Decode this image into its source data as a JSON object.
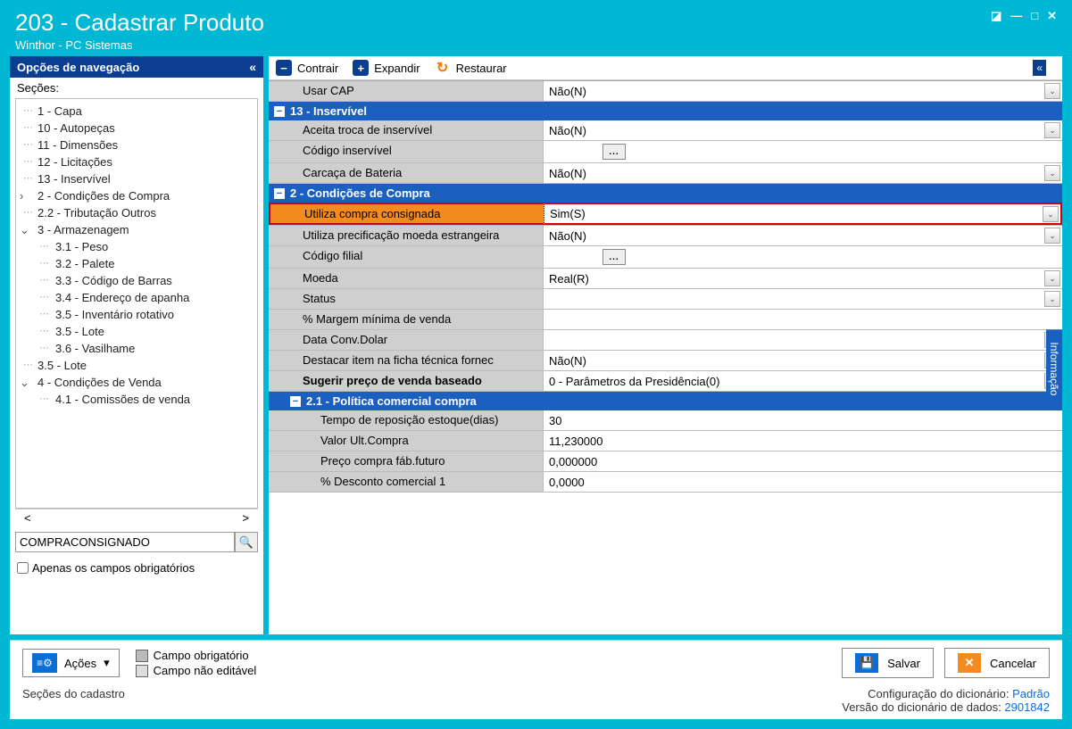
{
  "window": {
    "title": "203 - Cadastrar  Produto",
    "subtitle": "Winthor - PC Sistemas"
  },
  "sidebar": {
    "header": "Opções de navegação",
    "sections_label": "Seções:",
    "items": [
      {
        "label": "1 - Capa",
        "level": 1,
        "leaf": true
      },
      {
        "label": "10 - Autopeças",
        "level": 1,
        "leaf": true
      },
      {
        "label": "11 - Dimensões",
        "level": 1,
        "leaf": true
      },
      {
        "label": "12 - Licitações",
        "level": 1,
        "leaf": true
      },
      {
        "label": "13 - Inservível",
        "level": 1,
        "leaf": true
      },
      {
        "label": "2 - Condições de Compra",
        "level": 1,
        "toggle": ">"
      },
      {
        "label": "2.2 - Tributação Outros",
        "level": 1,
        "leaf": true
      },
      {
        "label": "3 - Armazenagem",
        "level": 1,
        "toggle": "v"
      },
      {
        "label": "3.1 - Peso",
        "level": 2
      },
      {
        "label": "3.2 - Palete",
        "level": 2
      },
      {
        "label": "3.3 - Código de Barras",
        "level": 2
      },
      {
        "label": "3.4 - Endereço de apanha",
        "level": 2
      },
      {
        "label": "3.5 - Inventário rotativo",
        "level": 2
      },
      {
        "label": "3.5 - Lote",
        "level": 2
      },
      {
        "label": "3.6 - Vasilhame",
        "level": 2
      },
      {
        "label": "3.5 - Lote",
        "level": 1,
        "leaf": true
      },
      {
        "label": "4 - Condições de Venda",
        "level": 1,
        "toggle": "v"
      },
      {
        "label": "4.1 - Comissões de venda",
        "level": 2
      }
    ],
    "search_value": "COMPRACONSIGNADO",
    "only_required": "Apenas os campos obrigatórios"
  },
  "toolbar": {
    "contract": "Contrair",
    "expand": "Expandir",
    "restore": "Restaurar"
  },
  "grid": {
    "r0": {
      "label": "Usar CAP",
      "value": "Não(N)",
      "dd": true
    },
    "s13": "13 - Inservível",
    "r13a": {
      "label": "Aceita troca de inservível",
      "value": "Não(N)",
      "dd": true
    },
    "r13b": {
      "label": "Código inservível",
      "value": "",
      "lookup": true
    },
    "r13c": {
      "label": "Carcaça de Bateria",
      "value": "Não(N)",
      "dd": true
    },
    "s2": "2 - Condições de Compra",
    "r2a": {
      "label": "Utiliza compra consignada",
      "value": "Sim(S)",
      "dd": true,
      "hl": true
    },
    "r2b": {
      "label": "Utiliza precificação moeda estrangeira",
      "value": "Não(N)",
      "dd": true
    },
    "r2c": {
      "label": "Código filial",
      "value": "",
      "lookup": true
    },
    "r2d": {
      "label": "Moeda",
      "value": "Real(R)",
      "dd": true
    },
    "r2e": {
      "label": "Status",
      "value": "",
      "dd": true
    },
    "r2f": {
      "label": "% Margem mínima de venda",
      "value": ""
    },
    "r2g": {
      "label": "Data Conv.Dolar",
      "value": "",
      "dd": true
    },
    "r2h": {
      "label": "Destacar item na ficha técnica fornec",
      "value": "Não(N)",
      "dd": true
    },
    "r2i": {
      "label": "Sugerir preço de venda baseado",
      "value": "0 - Parâmetros da Presidência(0)",
      "dd": true,
      "bold": true
    },
    "s21": "2.1 - Política comercial compra",
    "r21a": {
      "label": "Tempo de reposição estoque(dias)",
      "value": "30"
    },
    "r21b": {
      "label": "Valor Ult.Compra",
      "value": "11,230000"
    },
    "r21c": {
      "label": "Preço compra fáb.futuro",
      "value": "0,000000"
    },
    "r21d": {
      "label": "% Desconto comercial 1",
      "value": "0,0000"
    }
  },
  "info_tab": "Informação",
  "footer": {
    "acoes": "Ações",
    "legend_req": "Campo obrigatório",
    "legend_ro": "Campo não editável",
    "save": "Salvar",
    "cancel": "Cancelar"
  },
  "status": {
    "left": "Seções do cadastro",
    "cfg_label": "Configuração do dicionário:",
    "cfg_value": "Padrão",
    "ver_label": "Versão do dicionário de dados:",
    "ver_value": "2901842"
  }
}
